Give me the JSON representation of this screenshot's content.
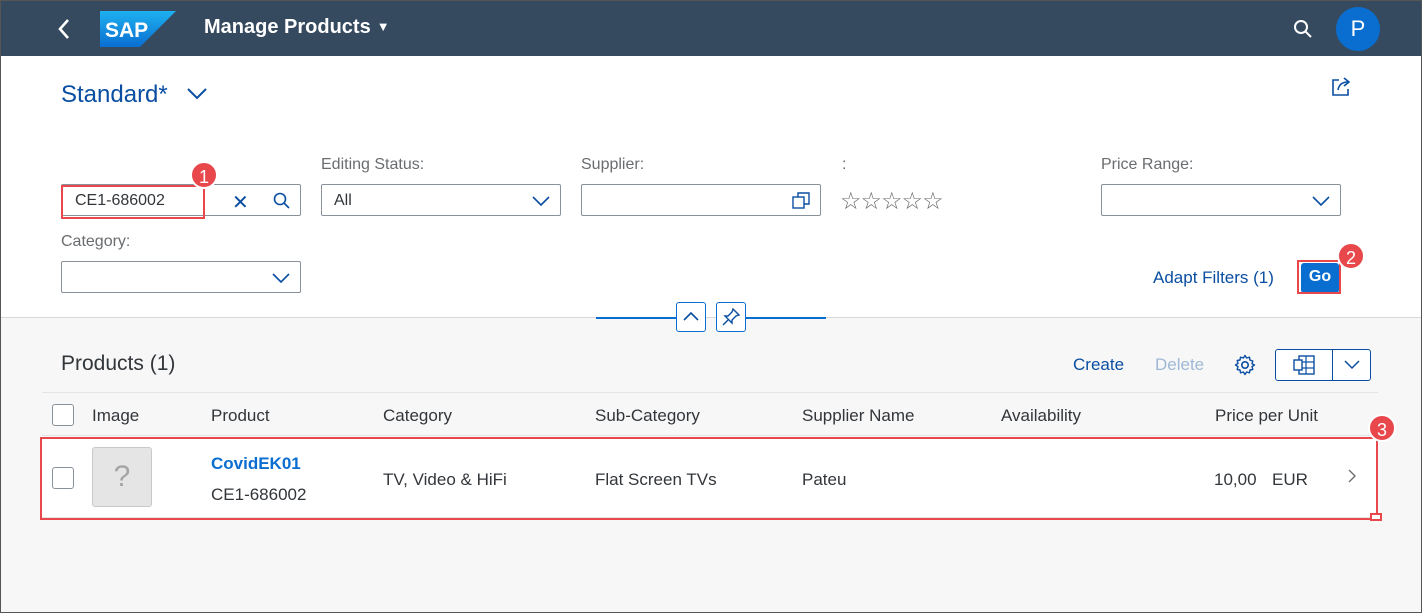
{
  "shell": {
    "back_icon": "chevron-left-icon",
    "logo_text": "SAP",
    "app_title": "Manage Products",
    "avatar_initial": "P",
    "brand_color": "#354a5f"
  },
  "header": {
    "variant": "Standard*",
    "search": {
      "value": "CE1-686002"
    },
    "filters": {
      "editing_status": {
        "label": "Editing Status:",
        "value": "All"
      },
      "supplier": {
        "label": "Supplier:",
        "value": ""
      },
      "rating": {
        "label": ":",
        "value": "☆☆☆☆☆"
      },
      "price_range": {
        "label": "Price Range:",
        "value": ""
      },
      "category": {
        "label": "Category:",
        "value": ""
      }
    },
    "adapt_filters": "Adapt Filters (1)",
    "go": "Go"
  },
  "annotations": [
    "1",
    "2",
    "3"
  ],
  "table": {
    "title": "Products (1)",
    "create": "Create",
    "delete": "Delete",
    "columns": [
      "Image",
      "Product",
      "Category",
      "Sub-Category",
      "Supplier Name",
      "Availability",
      "Price per Unit"
    ],
    "rows": [
      {
        "image": "?",
        "product_name": "CovidEK01",
        "product_id": "CE1-686002",
        "category": "TV, Video & HiFi",
        "sub_category": "Flat Screen TVs",
        "supplier": "Pateu",
        "availability": "",
        "price": "10,00",
        "currency": "EUR"
      }
    ]
  },
  "colors": {
    "accent": "#0a6ed1",
    "link": "#0a4ea2",
    "highlight": "#e8474b"
  }
}
